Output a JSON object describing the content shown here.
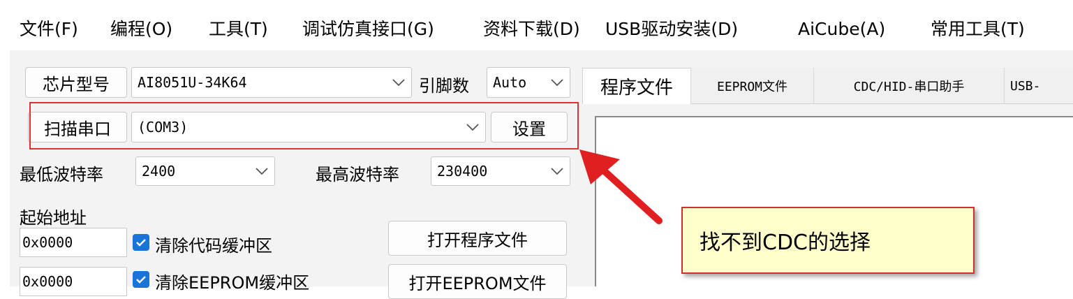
{
  "menubar": {
    "items": [
      {
        "label": "文件(F)"
      },
      {
        "label": "编程(O)"
      },
      {
        "label": "工具(T)"
      },
      {
        "label": "调试仿真接口(G)"
      },
      {
        "label": "资料下载(D)"
      },
      {
        "label": "USB驱动安装(D)"
      },
      {
        "label": "AiCube(A)"
      },
      {
        "label": "常用工具(T)"
      }
    ]
  },
  "left": {
    "chip_button": "芯片型号",
    "chip_model": "AI8051U-34K64",
    "pin_label": "引脚数",
    "pin_value": "Auto",
    "scan_button": "扫描串口",
    "port_value": "(COM3)",
    "settings_button": "设置",
    "min_baud_label": "最低波特率",
    "min_baud_value": "2400",
    "max_baud_label": "最高波特率",
    "max_baud_value": "230400",
    "start_addr_label": "起始地址",
    "addr1": "0x0000",
    "clear_code_label": "清除代码缓冲区",
    "open_program_button": "打开程序文件",
    "addr2": "0x0000",
    "clear_eeprom_label": "清除EEPROM缓冲区",
    "open_eeprom_button": "打开EEPROM文件"
  },
  "tabs": [
    {
      "label": "程序文件"
    },
    {
      "label": "EEPROM文件"
    },
    {
      "label": "CDC/HID-串口助手"
    },
    {
      "label": "USB-"
    }
  ],
  "annotation": {
    "callout_text": "找不到CDC的选择",
    "highlight_color": "#e03030",
    "callout_bg": "#ffffcc",
    "arrow_color": "#e02020"
  },
  "checkbox_color": "#1a73d9"
}
